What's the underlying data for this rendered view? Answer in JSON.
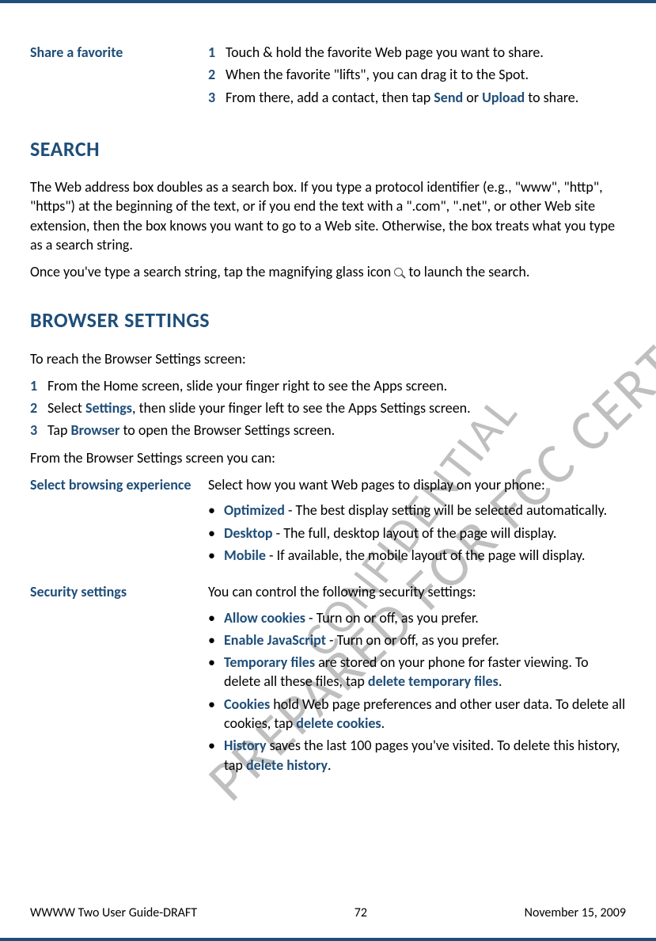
{
  "watermarks": {
    "wm1": "PREPARED FOR FCC CERTIFICATION",
    "wm2": "CONFIDENTIAL"
  },
  "share": {
    "heading": "Share a favorite",
    "step1": "Touch & hold the favorite Web page you want to share.",
    "step2": "When the favorite \"lifts\", you can drag it to the Spot.",
    "step3_pre": "From there, add a contact, then tap ",
    "step3_send": "Send",
    "step3_or": " or ",
    "step3_upload": "Upload",
    "step3_post": " to share."
  },
  "search": {
    "heading": "SEARCH",
    "para1": "The Web address box doubles as a search box. If you type a protocol identifier (e.g., \"www\", \"http\", \"https\") at the beginning of the text, or if you end the text with a \".com\", \".net\", or other Web site extension, then the box knows you want to go to a Web site. Otherwise, the box treats what you type as a search string.",
    "para2_pre": "Once you've type a search string, tap the magnifying glass icon ",
    "para2_post": " to launch the search."
  },
  "browser": {
    "heading": "BROWSER SETTINGS",
    "intro": "To reach the Browser Settings screen:",
    "step1": "From the Home screen, slide your finger right to see the Apps screen.",
    "step2_pre": "Select ",
    "step2_link": "Settings",
    "step2_post": ", then slide your finger left to see the Apps Settings screen.",
    "step3_pre": "Tap ",
    "step3_link": "Browser",
    "step3_post": " to open the Browser Settings screen.",
    "outro": "From the Browser Settings screen you can:"
  },
  "browsing_exp": {
    "heading": "Select browsing experience",
    "lead": "Select how you want Web pages to display on your phone:",
    "opt_label": "Optimized",
    "opt_text": " - The best display setting will be selected automatically.",
    "desk_label": "Desktop",
    "desk_text": " - The full, desktop layout of the page will display.",
    "mob_label": "Mobile",
    "mob_text": " - If available, the mobile layout of the page will display."
  },
  "security": {
    "heading": "Security settings",
    "lead": "You can control the following security settings:",
    "b1_label": "Allow cookies",
    "b1_text": " - Turn on or off, as you prefer.",
    "b2_label": "Enable JavaScript",
    "b2_text": " - Turn on or off, as you prefer.",
    "b3_label": "Temporary files",
    "b3_mid": " are stored on your phone for faster viewing. To delete all these files, tap ",
    "b3_action": "delete temporary files",
    "b3_end": ".",
    "b4_label": "Cookies",
    "b4_mid": " hold Web page preferences and other user data. To delete all cookies, tap ",
    "b4_action": "delete cookies",
    "b4_end": ".",
    "b5_label": "History",
    "b5_mid": " saves the last 100 pages you've visited. To delete this history, tap ",
    "b5_action": "delete history",
    "b5_end": "."
  },
  "footer": {
    "left": "WWWW Two User Guide-DRAFT",
    "center": "72",
    "right": "November 15, 2009"
  }
}
